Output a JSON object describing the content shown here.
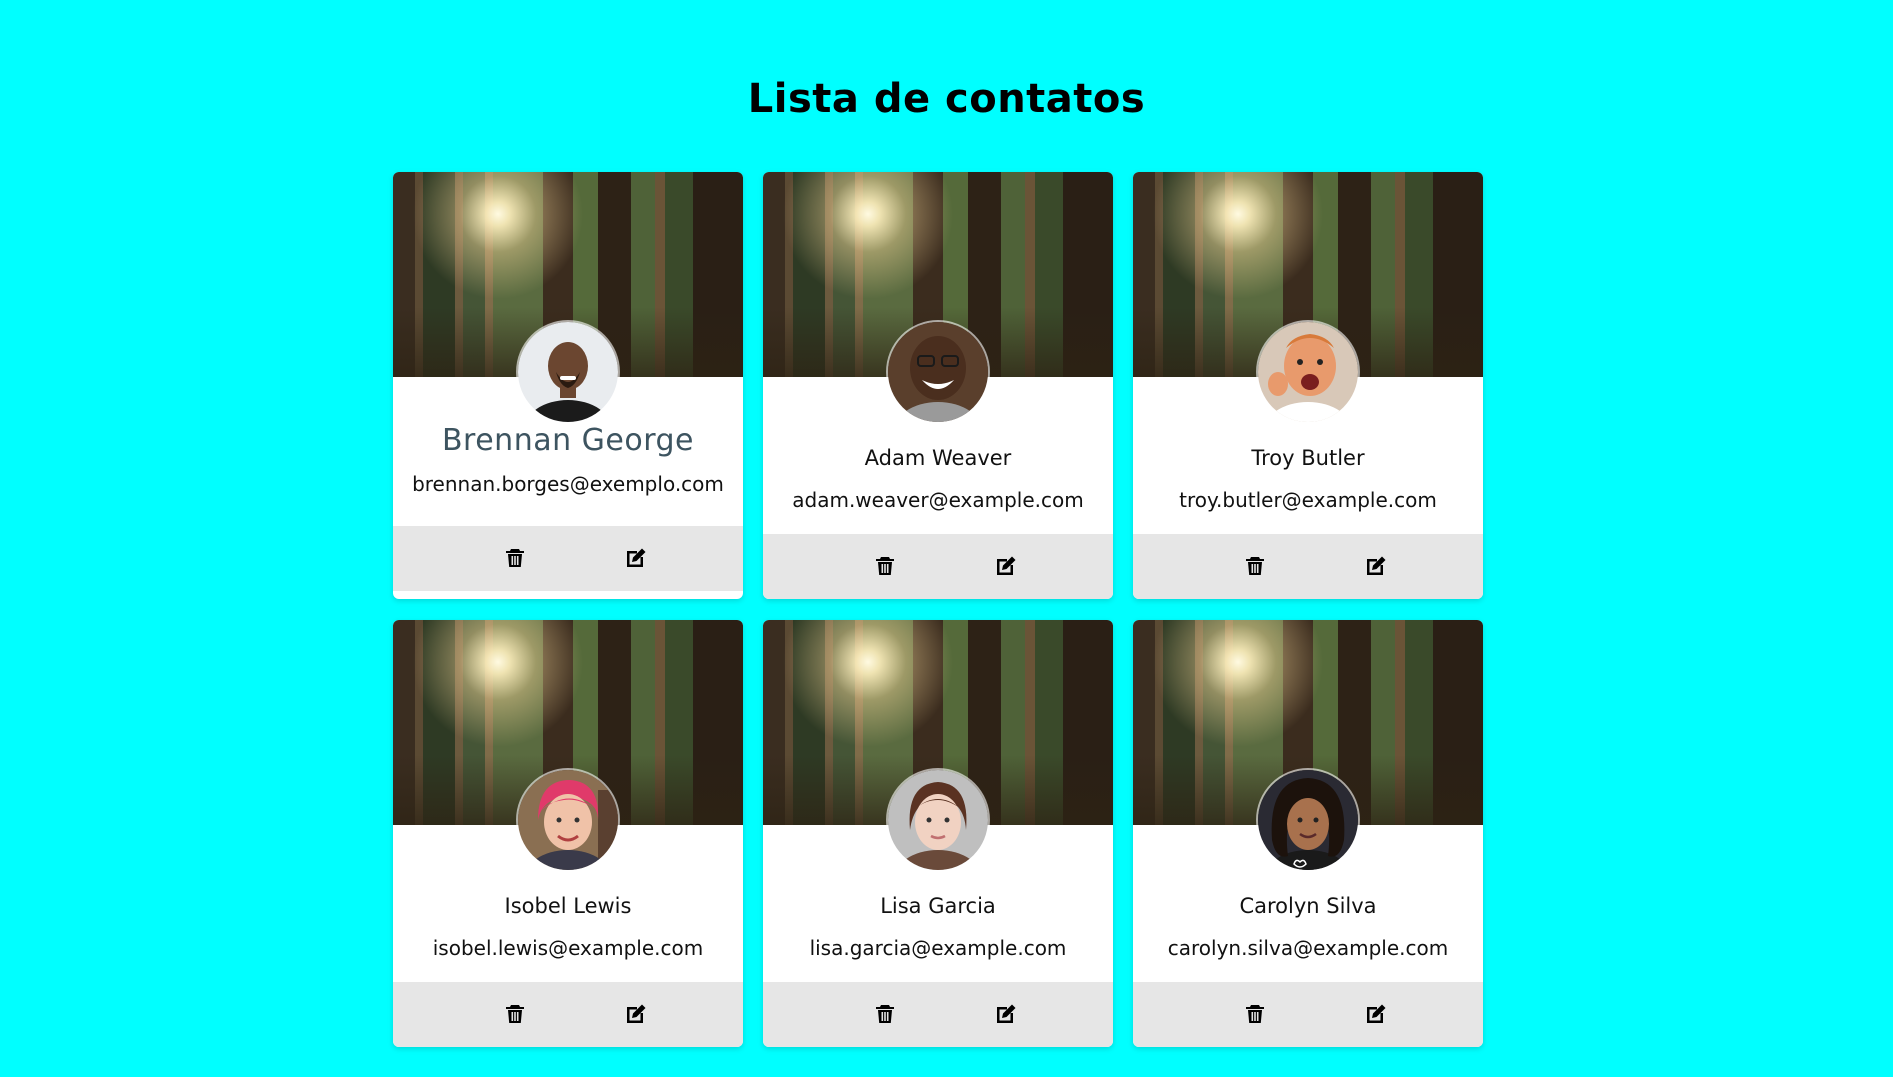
{
  "page": {
    "title": "Lista de contatos",
    "background_color": "#00ffff"
  },
  "contacts": [
    {
      "name": "Brennan George",
      "email": "brennan.borges@exemplo.com",
      "avatar_icon": "person-avatar-icon",
      "avatar_colors": {
        "bg": "#e9ecef",
        "skin": "#6b4630",
        "shirt": "#1b1b1b"
      }
    },
    {
      "name": "Adam Weaver",
      "email": "adam.weaver@example.com",
      "avatar_icon": "person-avatar-icon",
      "avatar_colors": {
        "bg": "#5a3f2c",
        "skin": "#4a2e1e",
        "shirt": "#9a9a9a"
      }
    },
    {
      "name": "Troy Butler",
      "email": "troy.butler@example.com",
      "avatar_icon": "person-avatar-icon",
      "avatar_colors": {
        "bg": "#d8c8b8",
        "skin": "#e89a6c",
        "shirt": "#ffffff"
      }
    },
    {
      "name": "Isobel Lewis",
      "email": "isobel.lewis@example.com",
      "avatar_icon": "person-avatar-icon",
      "avatar_colors": {
        "bg": "#8a6f52",
        "skin": "#f0c2a8",
        "shirt": "#e03a6a"
      }
    },
    {
      "name": "Lisa Garcia",
      "email": "lisa.garcia@example.com",
      "avatar_icon": "person-avatar-icon",
      "avatar_colors": {
        "bg": "#bfbfbf",
        "skin": "#f1d2c2",
        "shirt": "#6a4a3a"
      }
    },
    {
      "name": "Carolyn Silva",
      "email": "carolyn.silva@example.com",
      "avatar_icon": "person-avatar-icon",
      "avatar_colors": {
        "bg": "#2a2a33",
        "skin": "#a8714d",
        "shirt": "#1a1a1a"
      }
    }
  ],
  "actions": {
    "delete_icon": "trash-icon",
    "edit_icon": "edit-icon"
  }
}
